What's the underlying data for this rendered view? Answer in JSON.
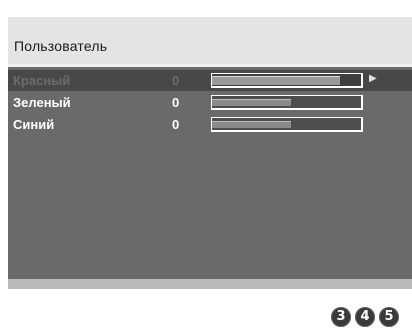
{
  "menu": {
    "title": "Пользователь",
    "rows": [
      {
        "label": "Красный",
        "value": "0",
        "level": 0.86,
        "selected": true,
        "arrow_icon": "arrow-right-icon"
      },
      {
        "label": "Зеленый",
        "value": "0",
        "level": 0.53,
        "selected": false
      },
      {
        "label": "Синий",
        "value": "0",
        "level": 0.53,
        "selected": false
      }
    ]
  },
  "page_badges": [
    "3",
    "4",
    "5"
  ],
  "colors": {
    "header": "#e4e4e4",
    "body": "#6a6a6a",
    "selected_row": "#484848",
    "bar_track": "#4e4e4e",
    "bar_fill": "#8a8a8a",
    "badge": "#3a3a3a"
  }
}
